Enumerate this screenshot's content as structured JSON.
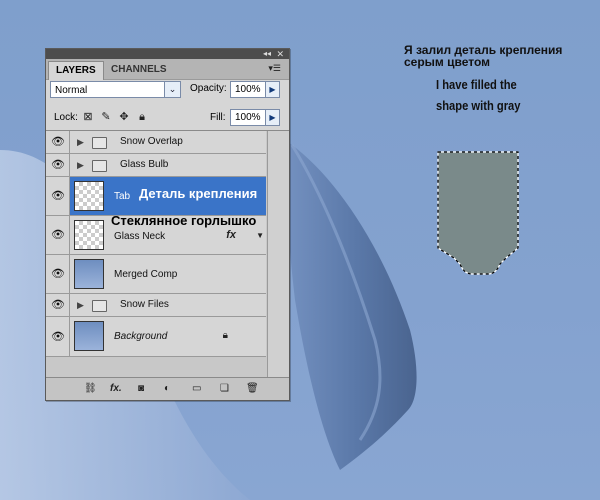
{
  "annotations": {
    "russian": "Я залил деталь крепления серым цветом",
    "english": "I have filled the shape with gray"
  },
  "panel": {
    "tabs": [
      {
        "label": "LAYERS",
        "active": true
      },
      {
        "label": "CHANNELS",
        "active": false
      }
    ],
    "blend_mode": "Normal",
    "opacity_label": "Opacity:",
    "opacity_value": "100%",
    "lock_label": "Lock:",
    "fill_label": "Fill:",
    "fill_value": "100%",
    "layers": [
      {
        "name": "Snow Overlap",
        "type": "group",
        "visible": true
      },
      {
        "name": "Glass Bulb",
        "type": "group",
        "visible": true
      },
      {
        "name": "Tab",
        "type": "layer",
        "visible": true,
        "selected": true,
        "overlay_label": "Деталь крепления"
      },
      {
        "name": "Glass Neck",
        "type": "layer",
        "visible": true,
        "fx": "fx",
        "overlay_label": "Стеклянное горлышко"
      },
      {
        "name": "Merged Comp",
        "type": "layer",
        "visible": true
      },
      {
        "name": "Snow Files",
        "type": "group",
        "visible": true
      },
      {
        "name": "Background",
        "type": "layer",
        "visible": true,
        "locked": true
      }
    ],
    "bottom_icons": [
      "link-icon",
      "fx-icon",
      "mask-icon",
      "adjustment-icon",
      "folder-icon",
      "new-layer-icon",
      "trash-icon"
    ]
  },
  "colors": {
    "canvas_bg": "#84a2cf",
    "shape_fill": "#7a8a8a",
    "selection": "#3a74c8"
  }
}
